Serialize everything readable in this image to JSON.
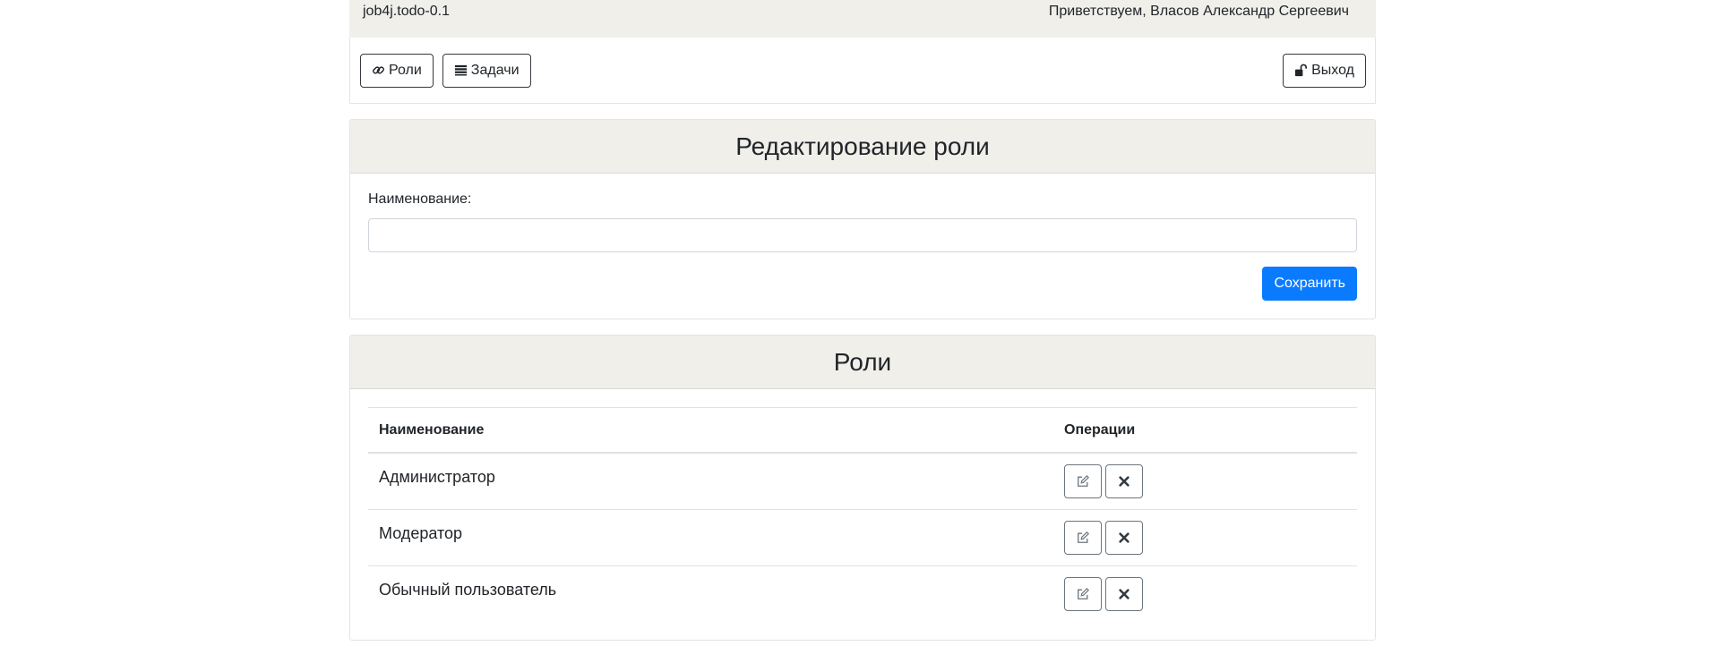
{
  "header": {
    "app_name": "job4j.todo-0.1",
    "greeting": "Приветствуем, Власов Александр Сергеевич"
  },
  "nav": {
    "roles_label": "Роли",
    "tasks_label": "Задачи",
    "logout_label": "Выход"
  },
  "edit_form": {
    "title": "Редактирование роли",
    "name_label": "Наименование:",
    "name_value": "",
    "save_label": "Сохранить"
  },
  "roles_table": {
    "title": "Роли",
    "columns": [
      "Наименование",
      "Операции"
    ],
    "rows": [
      {
        "name": "Администратор"
      },
      {
        "name": "Модератор"
      },
      {
        "name": "Обычный пользователь"
      }
    ]
  },
  "icons": {
    "roles": "link-icon",
    "tasks": "list-icon",
    "logout": "unlock-icon",
    "edit": "edit-icon",
    "delete": "close-icon"
  },
  "colors": {
    "primary": "#0a7bff",
    "header_bg": "#f0efea"
  }
}
